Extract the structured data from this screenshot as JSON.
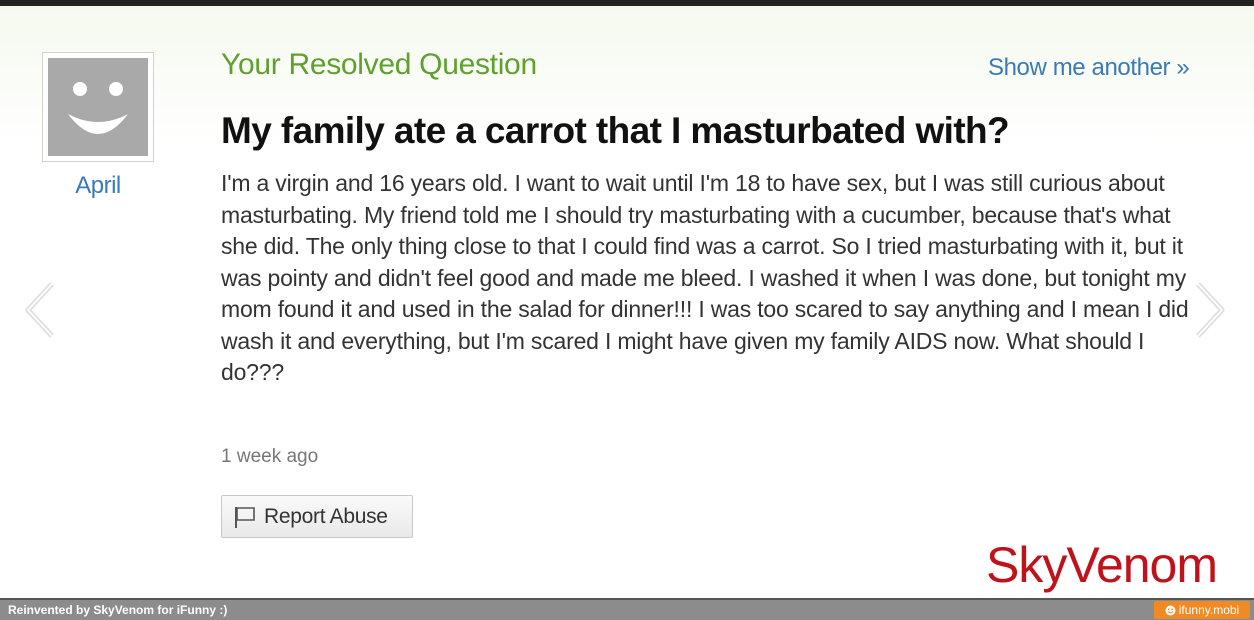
{
  "header": {
    "section_heading": "Your Resolved Question",
    "show_another": "Show me another »"
  },
  "asker": {
    "name": "April",
    "avatar_icon": "smiley-face-icon"
  },
  "question": {
    "title": "My family ate a carrot that I masturbated with?",
    "body": "I'm a virgin and 16 years old. I want to wait until I'm 18 to have sex, but I was still curious about masturbating. My friend told me I should try masturbating with a cucumber, because that's what she did. The only thing close to that I could find was a carrot. So I tried masturbating with it, but it was pointy and didn't feel good and made me bleed. I washed it when I was done, but tonight my mom found it and used in the salad for dinner!!! I was too scared to say anything and I mean I did wash it and everything, but I'm scared I might have given my family AIDS now. What should I do???",
    "timestamp": "1 week ago"
  },
  "actions": {
    "report_abuse": "Report Abuse",
    "report_icon": "flag-icon"
  },
  "navigation": {
    "prev_icon": "chevron-left-icon",
    "next_icon": "chevron-right-icon"
  },
  "watermark": "SkyVenom",
  "footer": {
    "credit": "Reinvented by SkyVenom for iFunny :)",
    "site": "ifunny.mobi",
    "site_icon": "smiley-icon"
  },
  "colors": {
    "heading_green": "#5ea12e",
    "link_blue": "#3a7ab8",
    "watermark_red": "#c0121b",
    "footer_gray": "#8c8c8c",
    "badge_orange": "#f08a24"
  }
}
